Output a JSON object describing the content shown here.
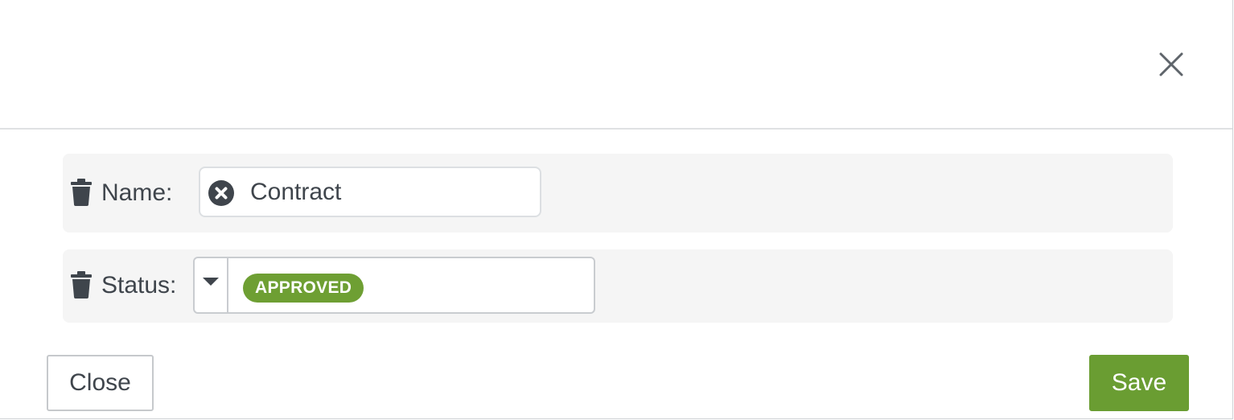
{
  "dialog": {
    "close_icon": "close-icon",
    "filters": {
      "name": {
        "label": "Name:",
        "value": "Contract",
        "icon_remove": "trash-icon",
        "icon_clear": "circle-x-icon"
      },
      "status": {
        "label": "Status:",
        "selected": "APPROVED",
        "icon_remove": "trash-icon",
        "icon_dropdown": "caret-down-icon",
        "tag_color": "#6e9f33"
      }
    },
    "footer": {
      "close_label": "Close",
      "save_label": "Save",
      "save_color": "#6a9d32"
    }
  }
}
